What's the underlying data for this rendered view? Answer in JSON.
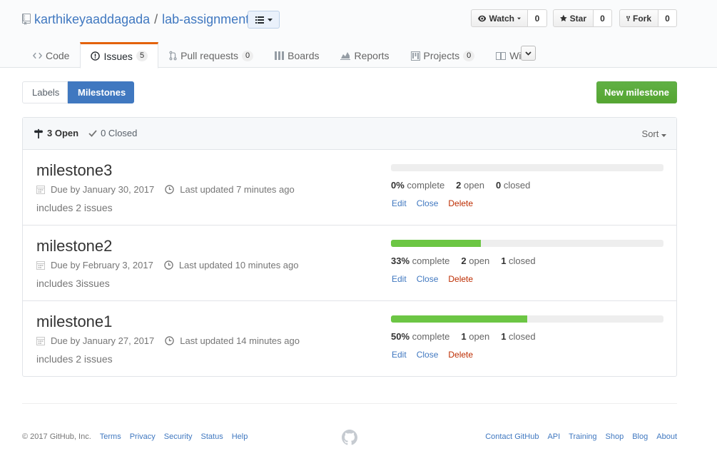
{
  "repo": {
    "owner": "karthikeyaaddagada",
    "separator": "/",
    "name": "lab-assignments"
  },
  "actions": {
    "watch": {
      "label": "Watch",
      "count": "0"
    },
    "star": {
      "label": "Star",
      "count": "0"
    },
    "fork": {
      "label": "Fork",
      "count": "0"
    }
  },
  "nav": {
    "code": "Code",
    "issues": {
      "label": "Issues",
      "count": "5"
    },
    "pulls": {
      "label": "Pull requests",
      "count": "0"
    },
    "boards": "Boards",
    "reports": "Reports",
    "projects": {
      "label": "Projects",
      "count": "0"
    },
    "wiki": "Wiki"
  },
  "subnav": {
    "labels": "Labels",
    "milestones": "Milestones"
  },
  "new_milestone": "New milestone",
  "states": {
    "open": "3 Open",
    "closed": "0 Closed"
  },
  "sort": "Sort",
  "milestones": [
    {
      "title": "milestone3",
      "due": "Due by January 30, 2017",
      "updated": "Last updated 7 minutes ago",
      "description": "includes 2 issues",
      "percent": 0,
      "percent_label": "0%",
      "complete_label": "complete",
      "open_count": "2",
      "open_label": "open",
      "closed_count": "0",
      "closed_label": "closed"
    },
    {
      "title": "milestone2",
      "due": "Due by February 3, 2017",
      "updated": "Last updated 10 minutes ago",
      "description": "includes 3issues",
      "percent": 33,
      "percent_label": "33%",
      "complete_label": "complete",
      "open_count": "2",
      "open_label": "open",
      "closed_count": "1",
      "closed_label": "closed"
    },
    {
      "title": "milestone1",
      "due": "Due by January 27, 2017",
      "updated": "Last updated 14 minutes ago",
      "description": "includes 2 issues",
      "percent": 50,
      "percent_label": "50%",
      "complete_label": "complete",
      "open_count": "1",
      "open_label": "open",
      "closed_count": "1",
      "closed_label": "closed"
    }
  ],
  "milestone_actions": {
    "edit": "Edit",
    "close": "Close",
    "delete": "Delete"
  },
  "footer": {
    "copyright": "© 2017 GitHub, Inc.",
    "left_links": [
      "Terms",
      "Privacy",
      "Security",
      "Status",
      "Help"
    ],
    "right_links": [
      "Contact GitHub",
      "API",
      "Training",
      "Shop",
      "Blog",
      "About"
    ]
  },
  "colors": {
    "link": "#4078c0",
    "progress": "#6cc644",
    "primary": "#60b044",
    "danger": "#bd2c00",
    "accent": "#e36209"
  },
  "icons": {
    "repo": "repo-icon",
    "issues": "issue-opened-icon",
    "code": "code-icon",
    "pulls": "git-pull-request-icon",
    "boards": "boards-icon",
    "reports": "graph-icon",
    "projects": "project-icon",
    "wiki": "book-icon",
    "watch": "eye-icon",
    "star": "star-icon",
    "fork": "repo-forked-icon",
    "open": "milestone-icon",
    "closed": "check-icon",
    "due": "calendar-icon",
    "updated": "clock-icon",
    "footer": "mark-github-icon"
  }
}
